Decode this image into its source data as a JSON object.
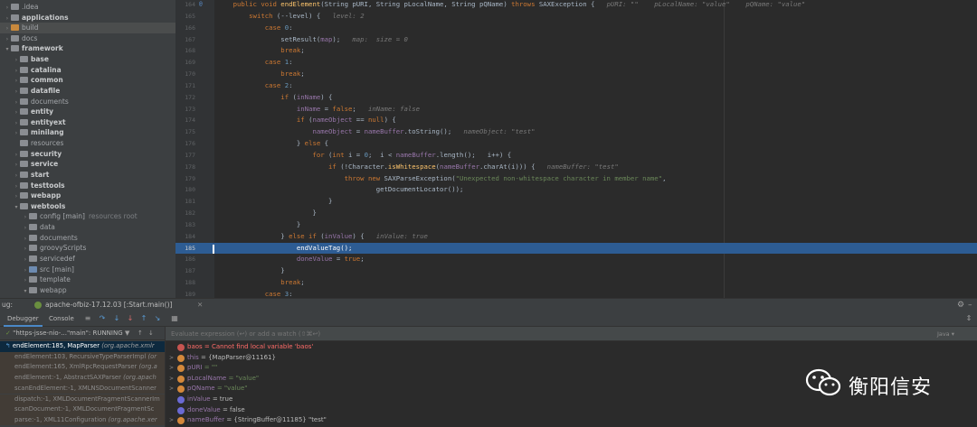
{
  "tree": {
    "items": [
      {
        "label": ".idea",
        "indent": 0,
        "arrow": ">",
        "bold": false,
        "color": "grey"
      },
      {
        "label": "applications",
        "indent": 0,
        "arrow": ">",
        "bold": true,
        "color": "grey"
      },
      {
        "label": "build",
        "indent": 0,
        "arrow": ">",
        "bold": false,
        "color": "orange",
        "selected": true
      },
      {
        "label": "docs",
        "indent": 0,
        "arrow": ">",
        "bold": false,
        "color": "grey"
      },
      {
        "label": "framework",
        "indent": 0,
        "arrow": "v",
        "bold": true,
        "color": "grey"
      },
      {
        "label": "base",
        "indent": 1,
        "arrow": ">",
        "bold": true,
        "color": "grey"
      },
      {
        "label": "catalina",
        "indent": 1,
        "arrow": ">",
        "bold": true,
        "color": "grey"
      },
      {
        "label": "common",
        "indent": 1,
        "arrow": ">",
        "bold": true,
        "color": "grey"
      },
      {
        "label": "datafile",
        "indent": 1,
        "arrow": ">",
        "bold": true,
        "color": "grey"
      },
      {
        "label": "documents",
        "indent": 1,
        "arrow": ">",
        "bold": false,
        "color": "grey"
      },
      {
        "label": "entity",
        "indent": 1,
        "arrow": ">",
        "bold": true,
        "color": "grey"
      },
      {
        "label": "entityext",
        "indent": 1,
        "arrow": ">",
        "bold": true,
        "color": "grey"
      },
      {
        "label": "minilang",
        "indent": 1,
        "arrow": ">",
        "bold": true,
        "color": "grey"
      },
      {
        "label": "resources",
        "indent": 1,
        "arrow": "",
        "bold": false,
        "color": "grey"
      },
      {
        "label": "security",
        "indent": 1,
        "arrow": ">",
        "bold": true,
        "color": "grey"
      },
      {
        "label": "service",
        "indent": 1,
        "arrow": ">",
        "bold": true,
        "color": "grey"
      },
      {
        "label": "start",
        "indent": 1,
        "arrow": ">",
        "bold": true,
        "color": "grey"
      },
      {
        "label": "testtools",
        "indent": 1,
        "arrow": ">",
        "bold": true,
        "color": "grey"
      },
      {
        "label": "webapp",
        "indent": 1,
        "arrow": ">",
        "bold": true,
        "color": "grey"
      },
      {
        "label": "webtools",
        "indent": 1,
        "arrow": "v",
        "bold": true,
        "color": "grey"
      },
      {
        "label": "config [main]",
        "extra": "resources root",
        "indent": 2,
        "arrow": ">",
        "bold": false,
        "color": "grey"
      },
      {
        "label": "data",
        "indent": 2,
        "arrow": ">",
        "bold": false,
        "color": "grey"
      },
      {
        "label": "documents",
        "indent": 2,
        "arrow": ">",
        "bold": false,
        "color": "grey"
      },
      {
        "label": "groovyScripts",
        "indent": 2,
        "arrow": ">",
        "bold": false,
        "color": "grey"
      },
      {
        "label": "servicedef",
        "indent": 2,
        "arrow": ">",
        "bold": false,
        "color": "grey"
      },
      {
        "label": "src [main]",
        "indent": 2,
        "arrow": ">",
        "bold": false,
        "color": "blue"
      },
      {
        "label": "template",
        "indent": 2,
        "arrow": ">",
        "bold": false,
        "color": "grey"
      },
      {
        "label": "webapp",
        "indent": 2,
        "arrow": "v",
        "bold": false,
        "color": "grey"
      }
    ]
  },
  "editor": {
    "exec_line": 185,
    "lines": [
      {
        "n": "164",
        "mark": "@",
        "code": [
          [
            "    ",
            ""
          ],
          [
            "public void ",
            "k"
          ],
          [
            "endElement",
            "fn"
          ],
          [
            "(String pURI, String pLocalName, String pQName) ",
            ""
          ],
          [
            "throws ",
            "k"
          ],
          [
            "SAXException {   ",
            ""
          ],
          [
            "pURI: \"\"    pLocalName: \"value\"    pQName: \"value\"",
            "inl"
          ]
        ]
      },
      {
        "n": "165",
        "code": [
          [
            "        ",
            ""
          ],
          [
            "switch ",
            "k"
          ],
          [
            "(--",
            ""
          ],
          [
            "level",
            ""
          ],
          [
            ") {   ",
            ""
          ],
          [
            "level: 2",
            "inl"
          ]
        ]
      },
      {
        "n": "166",
        "code": [
          [
            "            ",
            ""
          ],
          [
            "case ",
            "k"
          ],
          [
            "0",
            "num"
          ],
          [
            ":",
            ""
          ]
        ]
      },
      {
        "n": "167",
        "code": [
          [
            "                ",
            ""
          ],
          [
            "setResult(",
            ""
          ],
          [
            "map",
            "fld"
          ],
          [
            ");   ",
            ""
          ],
          [
            "map:  size = 0",
            "inl"
          ]
        ]
      },
      {
        "n": "168",
        "code": [
          [
            "                ",
            ""
          ],
          [
            "break",
            "k"
          ],
          [
            ";",
            ""
          ]
        ]
      },
      {
        "n": "169",
        "code": [
          [
            "            ",
            ""
          ],
          [
            "case ",
            "k"
          ],
          [
            "1",
            "num"
          ],
          [
            ":",
            ""
          ]
        ]
      },
      {
        "n": "170",
        "code": [
          [
            "                ",
            ""
          ],
          [
            "break",
            "k"
          ],
          [
            ";",
            ""
          ]
        ]
      },
      {
        "n": "171",
        "code": [
          [
            "            ",
            ""
          ],
          [
            "case ",
            "k"
          ],
          [
            "2",
            "num"
          ],
          [
            ":",
            ""
          ]
        ]
      },
      {
        "n": "172",
        "code": [
          [
            "                ",
            ""
          ],
          [
            "if ",
            "k"
          ],
          [
            "(",
            ""
          ],
          [
            "inName",
            "fld"
          ],
          [
            ") {",
            ""
          ]
        ]
      },
      {
        "n": "173",
        "code": [
          [
            "                    ",
            ""
          ],
          [
            "inName",
            "fld"
          ],
          [
            " = ",
            ""
          ],
          [
            "false",
            "k"
          ],
          [
            ";   ",
            ""
          ],
          [
            "inName: false",
            "inl"
          ]
        ]
      },
      {
        "n": "174",
        "code": [
          [
            "                    ",
            ""
          ],
          [
            "if ",
            "k"
          ],
          [
            "(",
            ""
          ],
          [
            "nameObject",
            "fld"
          ],
          [
            " == ",
            ""
          ],
          [
            "null",
            "k"
          ],
          [
            ") {",
            ""
          ]
        ]
      },
      {
        "n": "175",
        "code": [
          [
            "                        ",
            ""
          ],
          [
            "nameObject",
            "fld"
          ],
          [
            " = ",
            ""
          ],
          [
            "nameBuffer",
            "fld"
          ],
          [
            ".toString();   ",
            ""
          ],
          [
            "nameObject: \"test\"",
            "inl"
          ]
        ]
      },
      {
        "n": "176",
        "code": [
          [
            "                    ",
            ""
          ],
          [
            "} ",
            ""
          ],
          [
            "else ",
            "k"
          ],
          [
            "{",
            ""
          ]
        ]
      },
      {
        "n": "177",
        "code": [
          [
            "                        ",
            ""
          ],
          [
            "for ",
            "k"
          ],
          [
            "(",
            ""
          ],
          [
            "int ",
            "k"
          ],
          [
            "i = ",
            ""
          ],
          [
            "0",
            "num"
          ],
          [
            ";  i < ",
            ""
          ],
          [
            "nameBuffer",
            "fld"
          ],
          [
            ".length();   i++) {",
            ""
          ]
        ]
      },
      {
        "n": "178",
        "code": [
          [
            "                            ",
            ""
          ],
          [
            "if ",
            "k"
          ],
          [
            "(!Character.",
            ""
          ],
          [
            "isWhitespace",
            "fn"
          ],
          [
            "(",
            ""
          ],
          [
            "nameBuffer",
            "fld"
          ],
          [
            ".charAt(i))) {   ",
            ""
          ],
          [
            "nameBuffer: \"test\"",
            "inl"
          ]
        ]
      },
      {
        "n": "179",
        "code": [
          [
            "                                ",
            ""
          ],
          [
            "throw new ",
            "k"
          ],
          [
            "SAXParseException(",
            ""
          ],
          [
            "\"Unexpected non-whitespace character in member name\"",
            "str"
          ],
          [
            ",",
            ""
          ]
        ]
      },
      {
        "n": "180",
        "code": [
          [
            "                                        ",
            ""
          ],
          [
            "getDocumentLocator());",
            ""
          ]
        ]
      },
      {
        "n": "181",
        "code": [
          [
            "                            ",
            ""
          ],
          [
            "}",
            ""
          ]
        ]
      },
      {
        "n": "182",
        "code": [
          [
            "                        ",
            ""
          ],
          [
            "}",
            ""
          ]
        ]
      },
      {
        "n": "183",
        "code": [
          [
            "                    ",
            ""
          ],
          [
            "}",
            ""
          ]
        ]
      },
      {
        "n": "184",
        "code": [
          [
            "                ",
            ""
          ],
          [
            "} ",
            ""
          ],
          [
            "else if ",
            "k"
          ],
          [
            "(",
            ""
          ],
          [
            "inValue",
            "fld"
          ],
          [
            ") {   ",
            ""
          ],
          [
            "inValue: true",
            "inl"
          ]
        ]
      },
      {
        "n": "185",
        "code": [
          [
            "                    ",
            ""
          ],
          [
            "endValueTag();",
            ""
          ]
        ]
      },
      {
        "n": "186",
        "code": [
          [
            "                    ",
            ""
          ],
          [
            "doneValue",
            "fld"
          ],
          [
            " = ",
            ""
          ],
          [
            "true",
            "k"
          ],
          [
            ";",
            ""
          ]
        ]
      },
      {
        "n": "187",
        "code": [
          [
            "                ",
            ""
          ],
          [
            "}",
            ""
          ]
        ]
      },
      {
        "n": "188",
        "code": [
          [
            "                ",
            ""
          ],
          [
            "break",
            "k"
          ],
          [
            ";",
            ""
          ]
        ]
      },
      {
        "n": "189",
        "code": [
          [
            "            ",
            ""
          ],
          [
            "case ",
            "k"
          ],
          [
            "3",
            "num"
          ],
          [
            ":",
            ""
          ]
        ]
      }
    ]
  },
  "debug": {
    "label": "ug:",
    "session": "apache-ofbiz-17.12.03 [:Start.main()]",
    "tabs": {
      "debugger": "Debugger",
      "console": "Console"
    },
    "thread": "\"https-jsse-nio-...\"main\": RUNNING",
    "frames": [
      {
        "method": "endElement:185, MapParser",
        "cls": "(org.apache.xmlr",
        "selected": true
      },
      {
        "method": "endElement:103, RecursiveTypeParserImpl",
        "cls": "(or",
        "lib": true
      },
      {
        "method": "endElement:165, XmlRpcRequestParser",
        "cls": "(org.a",
        "lib": true
      },
      {
        "method": "endElement:-1, AbstractSAXParser",
        "cls": "(org.apach",
        "lib": true
      },
      {
        "method": "scanEndElement:-1, XMLNSDocumentScanner",
        "cls": "",
        "lib": true
      },
      {
        "method": "dispatch:-1, XMLDocumentFragmentScannerIm",
        "cls": "",
        "lib": true
      },
      {
        "method": "scanDocument:-1, XMLDocumentFragmentSc",
        "cls": "",
        "lib": true
      },
      {
        "method": "parse:-1, XML11Configuration",
        "cls": "(org.apache.xer",
        "lib": true
      }
    ],
    "eval_placeholder": "Evaluate expression (↩) or add a watch (⇧⌘↩)",
    "eval_lang": "Java ▾",
    "variables": [
      {
        "kind": "err",
        "expand": "",
        "name": "baos",
        "value": "= Cannot find local variable 'baos'"
      },
      {
        "kind": "fld",
        "expand": ">",
        "name": "this",
        "value": "= {MapParser@11161}"
      },
      {
        "kind": "fld",
        "expand": ">",
        "name": "pURI",
        "value": "= \"\""
      },
      {
        "kind": "fld",
        "expand": ">",
        "name": "pLocalName",
        "value": "= \"value\""
      },
      {
        "kind": "fld",
        "expand": ">",
        "name": "pQName",
        "value": "= \"value\""
      },
      {
        "kind": "prim",
        "expand": "",
        "name": "inValue",
        "value": "= true"
      },
      {
        "kind": "prim",
        "expand": "",
        "name": "doneValue",
        "value": "= false"
      },
      {
        "kind": "fld",
        "expand": ">",
        "name": "nameBuffer",
        "value": "= {StringBuffer@11185} \"test\""
      }
    ]
  },
  "watermark": {
    "text": "衡阳信安"
  },
  "colors": {
    "exec_line": "#2d5c93",
    "keyword": "#cc7832",
    "string": "#6a8759",
    "field": "#9876aa"
  }
}
